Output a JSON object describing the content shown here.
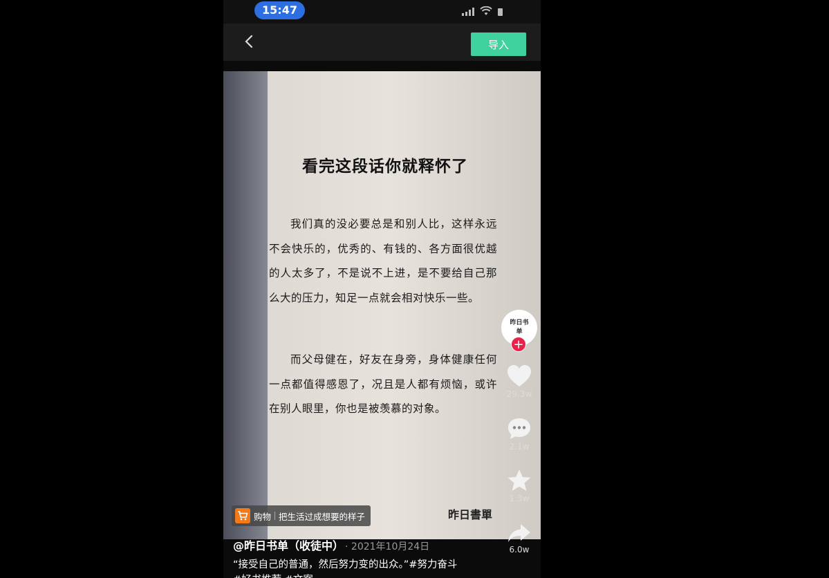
{
  "status_bar": {
    "time": "15:47"
  },
  "nav": {
    "import_label": "导入"
  },
  "book": {
    "title": "看完这段话你就释怀了",
    "paragraph_1": "我们真的没必要总是和别人比，这样永远不会快乐的，优秀的、有钱的、各方面很优越的人太多了，不是说不上进，是不要给自己那么大的压力，知足一点就会相对快乐一些。",
    "paragraph_2": "而父母健在，好友在身旁，身体健康任何一点都值得感恩了，况且是人都有烦恼，或许在别人眼里，你也是被羡慕的对象。",
    "signature": "昨日書單"
  },
  "shop_tag": {
    "label": "购物",
    "text": "把生活过成想要的样子"
  },
  "avatar": {
    "text": "昨日书单"
  },
  "actions": {
    "likes": "29.3w",
    "comments": "2.1w",
    "favorites": "1.3w",
    "shares": "6.0w"
  },
  "post": {
    "author": "@昨日书单（收徒中）",
    "date": "· 2021年10月24日",
    "caption": "“接受自己的普通，然后努力变的出众。”#努力奋斗 #好书推荐 #文案"
  },
  "colors": {
    "time_pill": "#2d6fe0",
    "import_button": "#3fd29f",
    "follow_plus": "#e8234b",
    "cart": "#f27a1a"
  }
}
